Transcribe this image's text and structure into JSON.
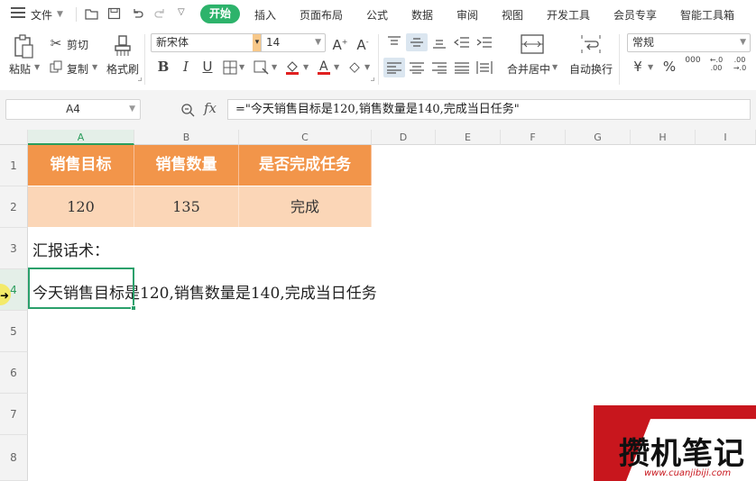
{
  "menubar": {
    "file_label": "文件",
    "tabs": [
      "开始",
      "插入",
      "页面布局",
      "公式",
      "数据",
      "审阅",
      "视图",
      "开发工具",
      "会员专享",
      "智能工具箱"
    ],
    "active_tab": "开始"
  },
  "ribbon": {
    "paste": "粘贴",
    "cut": "剪切",
    "copy": "复制",
    "format_painter": "格式刷",
    "font_name": "新宋体",
    "font_size": "14",
    "merge_center": "合并居中",
    "wrap_text": "自动换行",
    "number_format": "常规",
    "font_color": "#e02020",
    "fill_color": "#e02020"
  },
  "formula_bar": {
    "cell_ref": "A4",
    "fx": "fx",
    "formula": "=\"今天销售目标是120,销售数量是140,完成当日任务\""
  },
  "grid": {
    "columns": [
      "A",
      "B",
      "C",
      "D",
      "E",
      "F",
      "G",
      "H",
      "I"
    ],
    "rows": [
      "1",
      "2",
      "3",
      "4",
      "5",
      "6",
      "7",
      "8"
    ],
    "selected_cell": "A4",
    "table": {
      "headers": [
        "销售目标",
        "销售数量",
        "是否完成任务"
      ],
      "values": [
        "120",
        "135",
        "完成"
      ],
      "header_color": "#f2954a",
      "value_color": "#fbd6b7"
    },
    "a3": "汇报话术：",
    "a4": "今天销售目标是120,销售数量是140,完成当日任务"
  },
  "watermark": {
    "brand": "攒机笔记",
    "url": "www.cuanjibiji.com"
  }
}
